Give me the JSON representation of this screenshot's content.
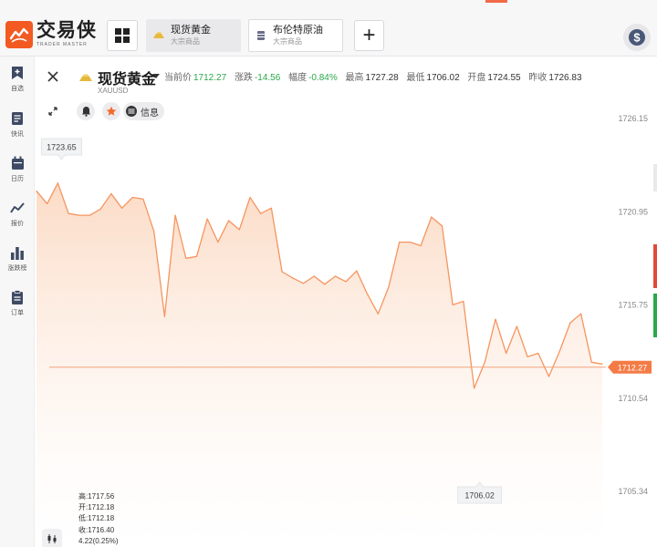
{
  "app": {
    "logo_title": "交易侠",
    "logo_sub": "TRADER MASTER"
  },
  "tabs": [
    {
      "name": "现货黄金",
      "sub": "大宗商品",
      "active": true,
      "icon": "gold-bar-icon"
    },
    {
      "name": "布伦特原油",
      "sub": "大宗商品",
      "active": false,
      "icon": "oil-barrel-icon"
    }
  ],
  "toolbar": {
    "add_label": "+",
    "dollar_label": "$"
  },
  "sidebar": {
    "items": [
      {
        "label": "自选",
        "icon": "bookmark-icon"
      },
      {
        "label": "快讯",
        "icon": "news-icon"
      },
      {
        "label": "日历",
        "icon": "calendar-icon"
      },
      {
        "label": "报价",
        "icon": "line-chart-icon"
      },
      {
        "label": "涨跌榜",
        "icon": "bar-chart-icon"
      },
      {
        "label": "订单",
        "icon": "clipboard-icon"
      }
    ]
  },
  "symbol": {
    "name": "现货黄金",
    "code": "XAUUSD"
  },
  "quote": {
    "current_label": "当前价",
    "current": "1712.27",
    "change_label": "涨跌",
    "change": "-14.56",
    "range_label": "幅度",
    "range": "-0.84%",
    "high_label": "最高",
    "high": "1727.28",
    "low_label": "最低",
    "low": "1706.02",
    "open_label": "开盘",
    "open": "1724.55",
    "prev_label": "昨收",
    "prev": "1726.83"
  },
  "actions": {
    "info_label": "信息"
  },
  "ohlc": {
    "high": "高:1717.56",
    "open": "开:1712.18",
    "low": "低:1712.18",
    "close": "收:1716.40",
    "change": "4.22(0.25%)"
  },
  "colors": {
    "accent": "#f25a22",
    "line": "#f5955f",
    "up": "#2ba84a",
    "down": "#e04a3a"
  },
  "chart_data": {
    "type": "area",
    "y_ticks": [
      "1726.15",
      "1720.95",
      "1715.75",
      "1710.54",
      "1705.34"
    ],
    "ylim": [
      1705.34,
      1726.15
    ],
    "current_price_label": "1712.27",
    "current_price": 1712.27,
    "max_label": "1723.65",
    "min_label": "1706.02",
    "values": [
      1722.1,
      1721.4,
      1722.55,
      1720.85,
      1720.75,
      1720.75,
      1721.1,
      1721.95,
      1721.15,
      1721.75,
      1721.65,
      1719.85,
      1715.1,
      1720.75,
      1718.35,
      1718.45,
      1720.55,
      1719.25,
      1720.45,
      1719.95,
      1721.75,
      1720.85,
      1721.15,
      1717.6,
      1717.25,
      1716.95,
      1717.35,
      1716.9,
      1717.35,
      1717.05,
      1717.65,
      1716.35,
      1715.25,
      1716.75,
      1719.25,
      1719.25,
      1719.05,
      1720.65,
      1720.15,
      1715.75,
      1715.95,
      1711.1,
      1712.55,
      1714.95,
      1713.05,
      1714.55,
      1712.85,
      1713.05,
      1711.75,
      1713.15,
      1714.75,
      1715.25,
      1712.55,
      1712.45
    ]
  }
}
